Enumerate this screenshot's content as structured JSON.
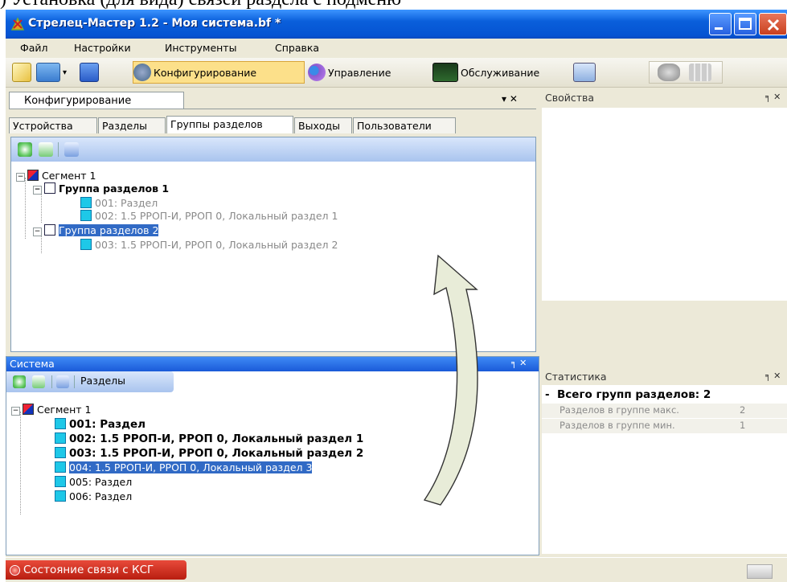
{
  "doc_text_top": ") Установка (для вида) связей раздела с подменю",
  "window": {
    "title": "Стрелец-Мастер 1.2 - Моя система.bf *"
  },
  "menu": [
    "Файл",
    "Настройки",
    "Инструменты",
    "Справка"
  ],
  "toolbar": {
    "configure": "Конфигурирование",
    "manage": "Управление",
    "service": "Обслуживание"
  },
  "config_panel": {
    "title": "Конфигурирование",
    "controls": "▾ ✕",
    "tabs": [
      "Устройства",
      "Разделы",
      "Группы разделов",
      "Выходы",
      "Пользователи"
    ],
    "tree": {
      "segment": "Сегмент 1",
      "group1": "Группа разделов 1",
      "group1_items": [
        "001: Раздел",
        "002: 1.5 РРОП-И,  РРОП 0, Локальный раздел 1"
      ],
      "group2": "Группа разделов 2",
      "group2_items": [
        "003: 1.5 РРОП-И,  РРОП 0, Локальный раздел 2"
      ]
    }
  },
  "properties_panel": {
    "title": "Свойства",
    "controls": "╕ ✕"
  },
  "system_panel": {
    "title": "Система",
    "controls": "╕ ✕",
    "toolbar_label": "Разделы",
    "tree": {
      "segment": "Сегмент 1",
      "items": [
        {
          "text": "001: Раздел",
          "style": "bold"
        },
        {
          "text": "002: 1.5 РРОП-И,  РРОП 0, Локальный раздел 1",
          "style": "bold"
        },
        {
          "text": "003: 1.5 РРОП-И,  РРОП 0, Локальный раздел 2",
          "style": "bold"
        },
        {
          "text": "004: 1.5 РРОП-И,  РРОП 0, Локальный раздел 3",
          "style": "selected"
        },
        {
          "text": "005: Раздел",
          "style": "normal"
        },
        {
          "text": "006: Раздел",
          "style": "normal"
        }
      ]
    }
  },
  "stats_panel": {
    "title": "Статистика",
    "controls": "╕ ✕",
    "total_label": "Всего групп разделов:",
    "total_value": "2",
    "rows": [
      {
        "label": "Разделов в группе макс.",
        "value": "2"
      },
      {
        "label": "Разделов в группе мин.",
        "value": "1"
      }
    ]
  },
  "statusbar": {
    "text": "Состояние связи с КСГ"
  }
}
